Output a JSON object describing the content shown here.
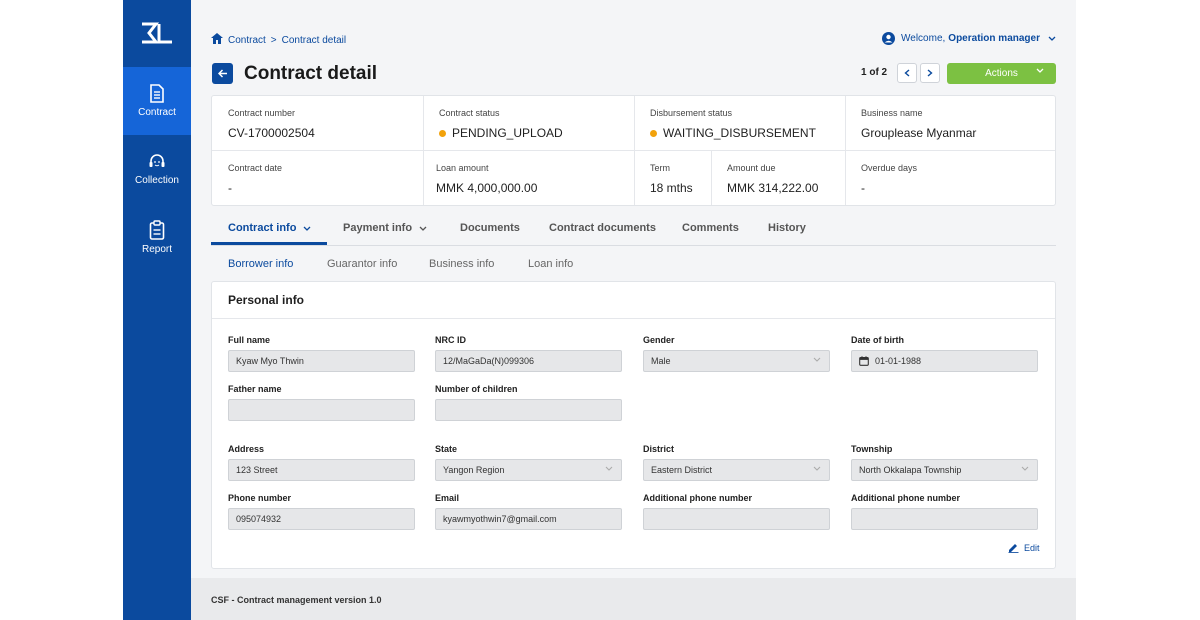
{
  "sidebar": {
    "items": [
      {
        "label": "Contract",
        "icon": "document-icon",
        "active": true
      },
      {
        "label": "Collection",
        "icon": "headset-icon",
        "active": false
      },
      {
        "label": "Report",
        "icon": "clipboard-icon",
        "active": false
      }
    ]
  },
  "breadcrumb": {
    "root": "Contract",
    "separator": ">",
    "current": "Contract detail"
  },
  "user": {
    "welcome": "Welcome,",
    "name": "Operation manager"
  },
  "header": {
    "title": "Contract detail",
    "pager": "1 of 2",
    "actions_label": "Actions"
  },
  "summary": {
    "contract_number": {
      "label": "Contract number",
      "value": "CV-1700002504"
    },
    "contract_status": {
      "label": "Contract status",
      "value": "PENDING_UPLOAD"
    },
    "disbursement_status": {
      "label": "Disbursement status",
      "value": "WAITING_DISBURSEMENT"
    },
    "business_name": {
      "label": "Business name",
      "value": "Grouplease Myanmar"
    },
    "contract_date": {
      "label": "Contract date",
      "value": "-"
    },
    "loan_amount": {
      "label": "Loan amount",
      "value": "MMK 4,000,000.00"
    },
    "term": {
      "label": "Term",
      "value": "18 mths"
    },
    "amount_due": {
      "label": "Amount due",
      "value": "MMK 314,222.00"
    },
    "overdue_days": {
      "label": "Overdue days",
      "value": "-"
    }
  },
  "tabs": [
    "Contract info",
    "Payment info",
    "Documents",
    "Contract documents",
    "Comments",
    "History"
  ],
  "subtabs": [
    "Borrower info",
    "Guarantor info",
    "Business info",
    "Loan info"
  ],
  "personal": {
    "title": "Personal info",
    "full_name": {
      "label": "Full name",
      "value": "Kyaw Myo Thwin"
    },
    "nrc_id": {
      "label": "NRC ID",
      "value": "12/MaGaDa(N)099306"
    },
    "gender": {
      "label": "Gender",
      "value": "Male"
    },
    "dob": {
      "label": "Date of birth",
      "value": "01-01-1988"
    },
    "father_name": {
      "label": "Father name",
      "value": ""
    },
    "children": {
      "label": "Number of children",
      "value": ""
    },
    "address": {
      "label": "Address",
      "value": "123 Street"
    },
    "state": {
      "label": "State",
      "value": "Yangon Region"
    },
    "district": {
      "label": "District",
      "value": "Eastern District"
    },
    "township": {
      "label": "Township",
      "value": "North Okkalapa Township"
    },
    "phone": {
      "label": "Phone number",
      "value": "095074932"
    },
    "email": {
      "label": "Email",
      "value": "kyawmyothwin7@gmail.com"
    },
    "add_phone_1": {
      "label": "Additional phone number",
      "value": ""
    },
    "add_phone_2": {
      "label": "Additional phone number",
      "value": ""
    },
    "edit_label": "Edit"
  },
  "footer": {
    "text": "CSF - Contract management version 1.0"
  },
  "colors": {
    "primary": "#0b4a9e",
    "nav_active": "#1565d8",
    "actions": "#7cc142",
    "status_dot": "#f2a20b"
  }
}
